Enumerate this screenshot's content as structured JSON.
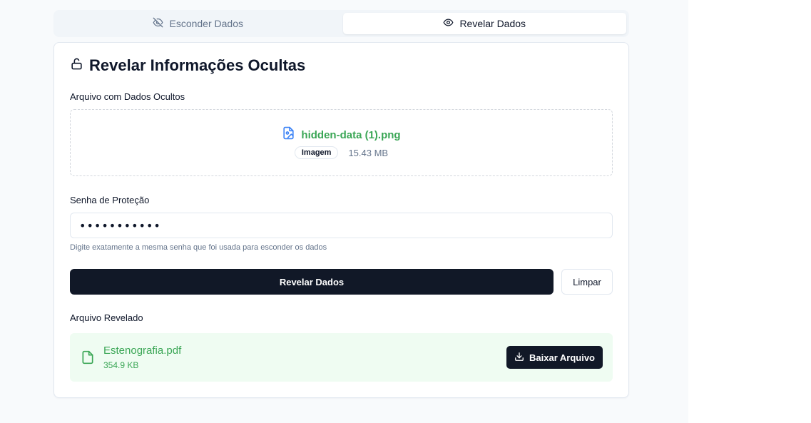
{
  "tabs": [
    {
      "label": "Esconder Dados",
      "icon": "eye-off-icon",
      "active": false
    },
    {
      "label": "Revelar Dados",
      "icon": "eye-icon",
      "active": true
    }
  ],
  "card": {
    "title": "Revelar Informações Ocultas",
    "title_icon": "unlock-icon"
  },
  "upload": {
    "label": "Arquivo com Dados Ocultos",
    "file_name": "hidden-data (1).png",
    "file_type_badge": "Imagem",
    "file_size": "15.43 MB",
    "file_icon": "image-file-icon"
  },
  "password": {
    "label": "Senha de Proteção",
    "value": "•••••••••••",
    "hint": "Digite exatamente a mesma senha que foi usada para esconder os dados"
  },
  "actions": {
    "reveal_label": "Revelar Dados",
    "clear_label": "Limpar"
  },
  "result": {
    "label": "Arquivo Revelado",
    "file_name": "Estenografia.pdf",
    "file_size": "354.9 KB",
    "download_label": "Baixar Arquivo"
  },
  "colors": {
    "accent_green": "#3aa655",
    "dark_button": "#111827",
    "success_bg": "#effcf2",
    "file_icon_blue": "#3b82f6"
  }
}
